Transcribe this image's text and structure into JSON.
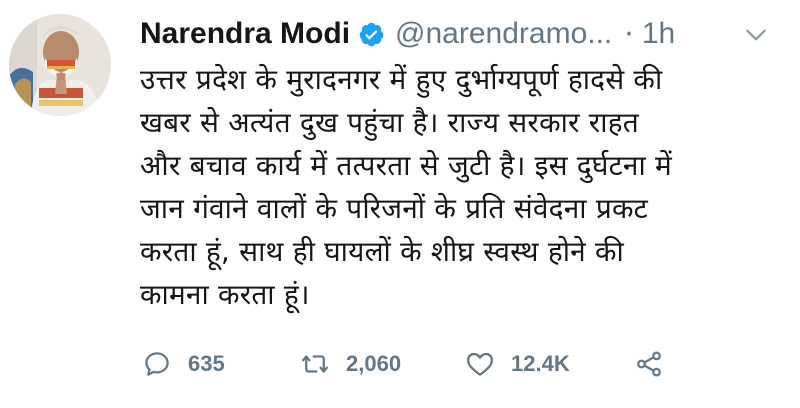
{
  "tweet": {
    "author_name": "Narendra Modi",
    "handle": "@narendramo...",
    "separator": "·",
    "time": "1h",
    "text": "उत्तर प्रदेश के मुरादनगर में हुए दुर्भाग्यपूर्ण हादसे की\nखबर से अत्यंत दुख पहुंचा है। राज्य सरकार राहत\nऔर बचाव कार्य में तत्परता से जुटी है। इस दुर्घटना में\nजान गंवाने वालों के परिजनों के प्रति संवेदना प्रकट\nकरता हूं, साथ ही घायलों के शीघ्र स्वस्थ होने की\nकामना करता हूं।"
  },
  "actions": {
    "replies": "635",
    "retweets": "2,060",
    "likes": "12.4K"
  },
  "icons": {
    "verified": "verified-badge-icon",
    "caret": "chevron-down-icon",
    "reply": "reply-icon",
    "retweet": "retweet-icon",
    "like": "heart-icon",
    "share": "share-icon"
  },
  "colors": {
    "text": "#14171a",
    "secondary": "#657786",
    "verified": "#1da1f2",
    "icon": "#657786"
  }
}
